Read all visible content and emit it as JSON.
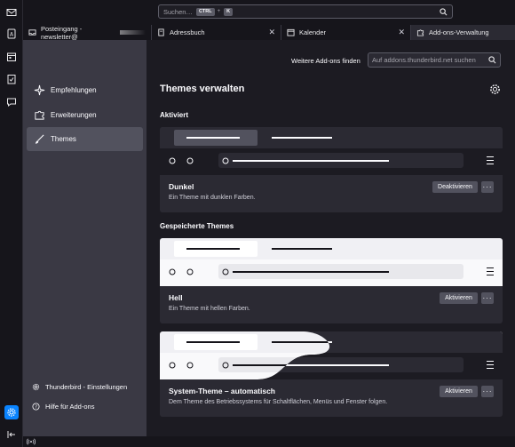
{
  "search": {
    "placeholder": "Suchen…",
    "shortcut_key1": "CTRL",
    "shortcut_sep": "+",
    "shortcut_key2": "K"
  },
  "spaces": [
    {
      "icon": "mail-icon"
    },
    {
      "icon": "address-book-icon"
    },
    {
      "icon": "calendar-icon"
    },
    {
      "icon": "tasks-icon"
    },
    {
      "icon": "chat-icon"
    },
    {
      "icon": "settings-icon",
      "active": true
    },
    {
      "icon": "collapse-icon"
    }
  ],
  "tabs": [
    {
      "label": "Posteingang - newsletter@",
      "icon": "inbox-icon",
      "closable": false
    },
    {
      "label": "Adressbuch",
      "icon": "address-book-icon",
      "closable": true
    },
    {
      "label": "Kalender",
      "icon": "calendar-icon",
      "closable": true
    },
    {
      "label": "Add-ons-Verwaltung",
      "icon": "puzzle-icon",
      "closable": false,
      "active": true
    }
  ],
  "sidebar": {
    "categories": [
      {
        "label": "Empfehlungen",
        "icon": "sparkle-icon"
      },
      {
        "label": "Erweiterungen",
        "icon": "puzzle-icon"
      },
      {
        "label": "Themes",
        "icon": "brush-icon",
        "selected": true
      }
    ],
    "footer": [
      {
        "label": "Thunderbird - Einstellungen",
        "icon": "gear-icon"
      },
      {
        "label": "Hilfe für Add-ons",
        "icon": "help-icon"
      }
    ]
  },
  "main": {
    "find_label": "Weitere Add-ons finden",
    "find_placeholder": "Auf addons.thunderbird.net suchen",
    "title": "Themes verwalten",
    "section_active": "Aktiviert",
    "section_saved": "Gespeicherte Themes",
    "themes": [
      {
        "name": "Dunkel",
        "description": "Ein Theme mit dunklen Farben.",
        "button": "Deaktivieren",
        "more": "···"
      },
      {
        "name": "Hell",
        "description": "Ein Theme mit hellen Farben.",
        "button": "Aktivieren",
        "more": "···"
      },
      {
        "name": "System-Theme – automatisch",
        "description": "Dem Theme des Betriebssystems für Schaltflächen, Menüs und Fenster folgen.",
        "button": "Aktivieren",
        "more": "···"
      }
    ]
  },
  "colors": {
    "accent": "#0a84ff",
    "bg": "#1c1b22",
    "card": "#2b2a33",
    "sidebar": "#3a3944",
    "button": "#52525e"
  }
}
